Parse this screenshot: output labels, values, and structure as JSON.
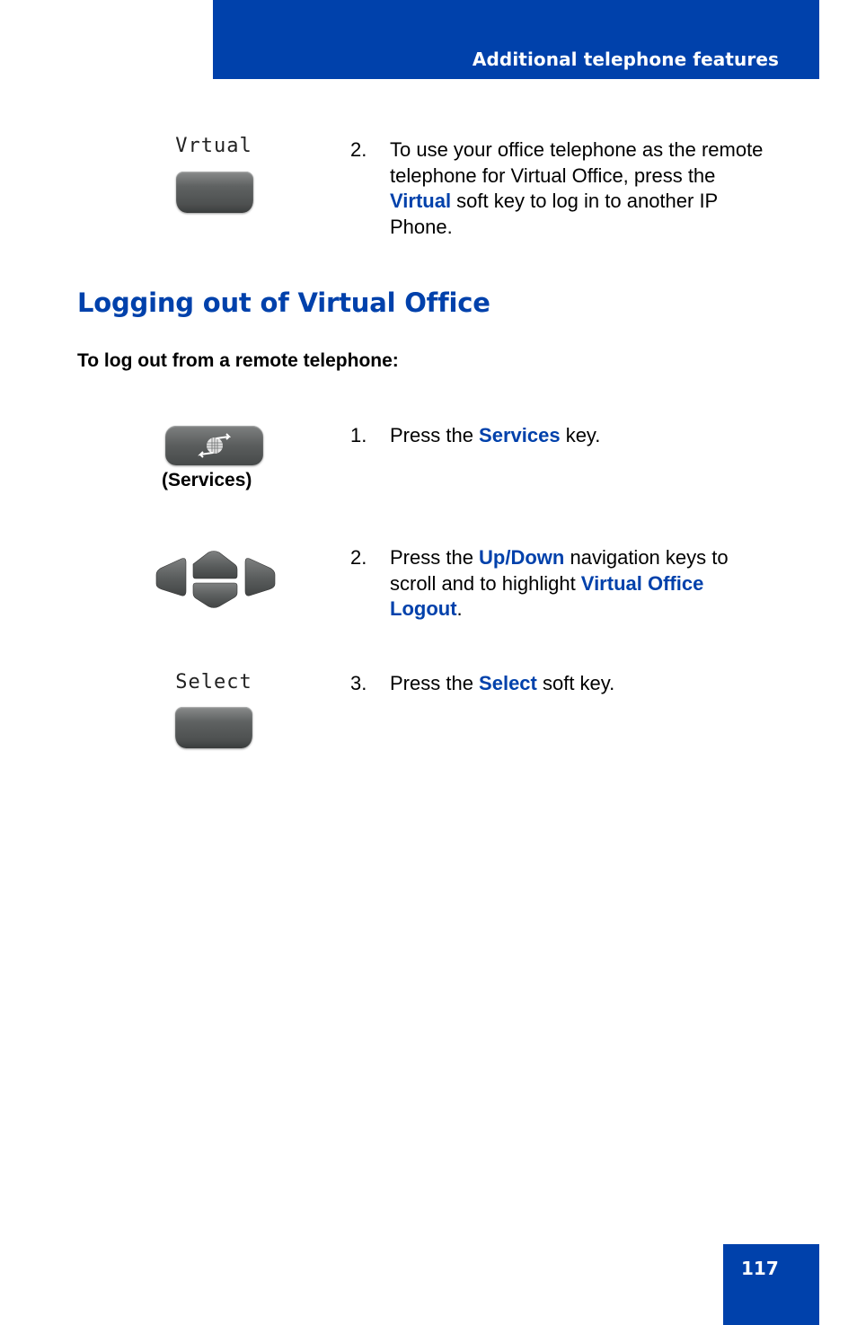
{
  "header": {
    "title": "Additional telephone features"
  },
  "page_number": "117",
  "top_step": {
    "lcd_label": "Vrtual",
    "number": "2.",
    "text_parts": [
      {
        "text": "To use your office telephone as the remote telephone for Virtual Office, press the ",
        "highlight": false
      },
      {
        "text": "Virtual",
        "highlight": true
      },
      {
        "text": " soft key to log in to another IP Phone.",
        "highlight": false
      }
    ]
  },
  "section": {
    "title": "Logging out of Virtual Office",
    "intro": "To log out from a remote telephone:"
  },
  "steps": [
    {
      "number": "1.",
      "icon": "services-key",
      "caption": "(Services)",
      "text_parts": [
        {
          "text": "Press the ",
          "highlight": false
        },
        {
          "text": "Services",
          "highlight": true
        },
        {
          "text": " key.",
          "highlight": false
        }
      ]
    },
    {
      "number": "2.",
      "icon": "navigation-keys",
      "text_parts": [
        {
          "text": "Press the ",
          "highlight": false
        },
        {
          "text": "Up/Down",
          "highlight": true
        },
        {
          "text": " navigation keys to scroll and to highlight ",
          "highlight": false
        },
        {
          "text": "Virtual Office Logout",
          "highlight": true
        },
        {
          "text": ".",
          "highlight": false
        }
      ]
    },
    {
      "number": "3.",
      "icon": "soft-key",
      "lcd_label": "Select",
      "text_parts": [
        {
          "text": "Press the ",
          "highlight": false
        },
        {
          "text": "Select",
          "highlight": true
        },
        {
          "text": " soft key.",
          "highlight": false
        }
      ]
    }
  ],
  "colors": {
    "brand_blue": "#0041ab",
    "key_gray": "#5a5d5d"
  }
}
